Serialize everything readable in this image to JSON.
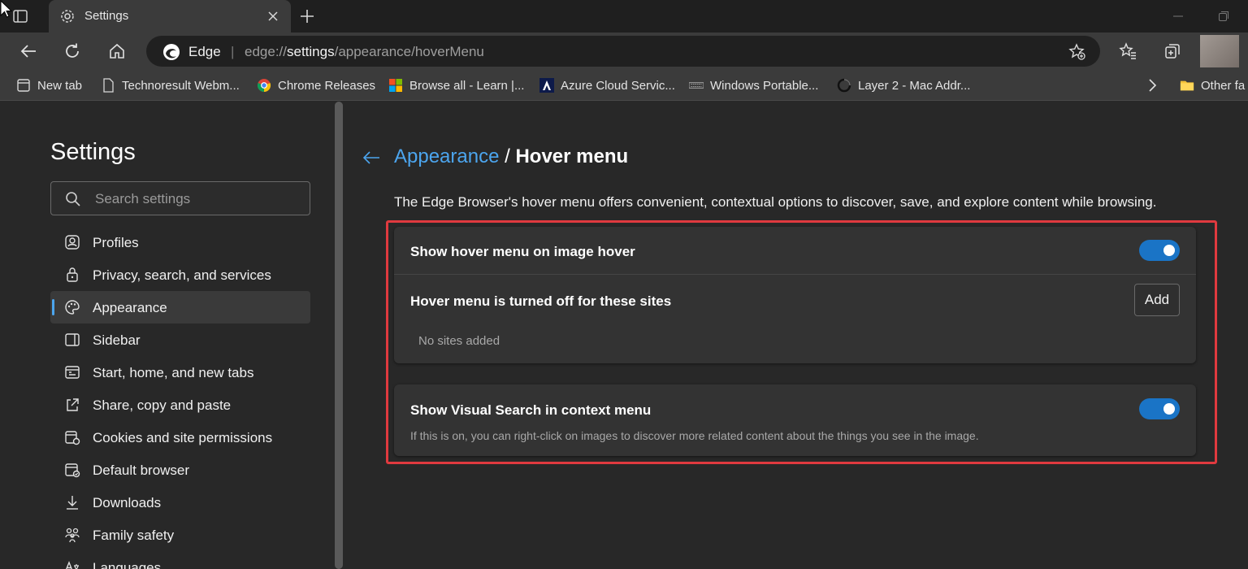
{
  "tab": {
    "title": "Settings"
  },
  "address_bar": {
    "site_name": "Edge",
    "separator": "|",
    "url_prefix": "edge://",
    "url_host": "settings",
    "url_path": "/appearance/hoverMenu"
  },
  "bookmarks": [
    {
      "label": "New tab",
      "icon": "new-tab-icon"
    },
    {
      "label": "Technoresult Webm...",
      "icon": "page-icon"
    },
    {
      "label": "Chrome Releases",
      "icon": "chrome-icon"
    },
    {
      "label": "Browse all - Learn |...",
      "icon": "microsoft-icon"
    },
    {
      "label": "Azure Cloud Servic...",
      "icon": "azure-icon"
    },
    {
      "label": "Windows Portable...",
      "icon": "windows-portable-icon"
    },
    {
      "label": "Layer 2 - Mac Addr...",
      "icon": "spinner-icon"
    },
    {
      "label": "Other fa",
      "icon": "folder-icon"
    }
  ],
  "sidebar": {
    "title": "Settings",
    "search_placeholder": "Search settings",
    "items": [
      {
        "label": "Profiles",
        "icon": "profile-icon"
      },
      {
        "label": "Privacy, search, and services",
        "icon": "lock-icon"
      },
      {
        "label": "Appearance",
        "icon": "palette-icon",
        "active": true
      },
      {
        "label": "Sidebar",
        "icon": "sidebar-icon"
      },
      {
        "label": "Start, home, and new tabs",
        "icon": "home-tabs-icon"
      },
      {
        "label": "Share, copy and paste",
        "icon": "share-icon"
      },
      {
        "label": "Cookies and site permissions",
        "icon": "cookies-icon"
      },
      {
        "label": "Default browser",
        "icon": "default-browser-icon"
      },
      {
        "label": "Downloads",
        "icon": "download-icon"
      },
      {
        "label": "Family safety",
        "icon": "family-icon"
      },
      {
        "label": "Languages",
        "icon": "languages-icon"
      }
    ]
  },
  "main": {
    "breadcrumb_parent": "Appearance",
    "breadcrumb_separator": "/",
    "breadcrumb_current": "Hover menu",
    "description": "The Edge Browser's hover menu offers convenient, contextual options to discover, save, and explore content while browsing.",
    "hover_menu_toggle": {
      "label": "Show hover menu on image hover",
      "on": true
    },
    "turned_off_sites": {
      "label": "Hover menu is turned off for these sites",
      "add_button": "Add",
      "empty_text": "No sites added"
    },
    "visual_search": {
      "label": "Show Visual Search in context menu",
      "description": "If this is on, you can right-click on images to discover more related content about the things you see in the image.",
      "on": true
    }
  },
  "colors": {
    "accent": "#4ca5ee",
    "toggle_on": "#1a74c6",
    "highlight_box": "#e03a3f"
  }
}
